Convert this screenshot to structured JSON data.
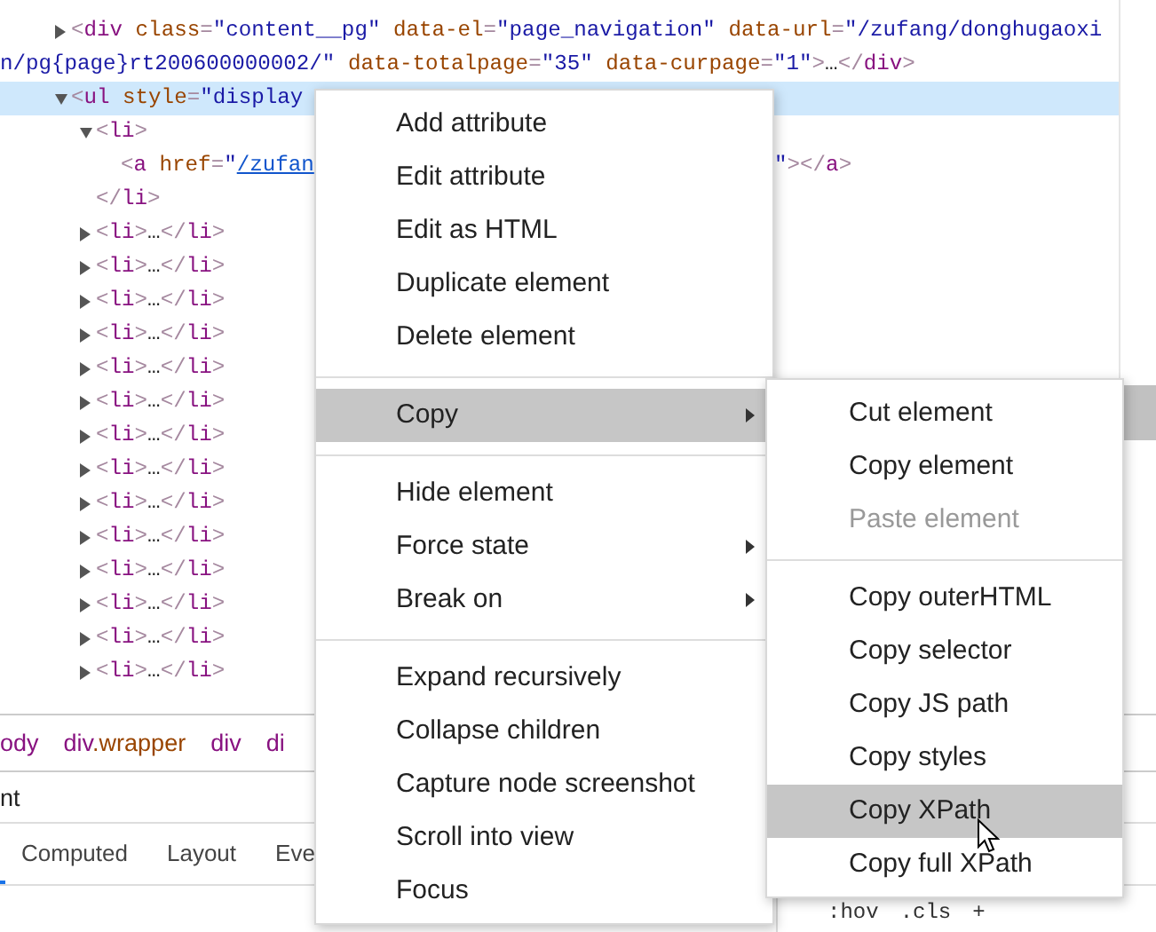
{
  "elements_tree": [
    {
      "expanded": false,
      "selected": false,
      "tokens": [
        {
          "kind": "punct",
          "text": "<"
        },
        {
          "kind": "tag",
          "text": "div"
        },
        {
          "kind": "attr",
          "text": " class"
        },
        {
          "kind": "punct",
          "text": "="
        },
        {
          "kind": "value",
          "text": "\"content__pg\""
        },
        {
          "kind": "attr",
          "text": " data-el"
        },
        {
          "kind": "punct",
          "text": "="
        },
        {
          "kind": "value",
          "text": "\"page_navigation\""
        },
        {
          "kind": "attr",
          "text": " data-url"
        },
        {
          "kind": "punct",
          "text": "="
        },
        {
          "kind": "value",
          "text": "\"/zufang/donghugaoxin/pg{page}rt200600000002/\""
        },
        {
          "kind": "attr",
          "text": " data-totalpage"
        },
        {
          "kind": "punct",
          "text": "="
        },
        {
          "kind": "value",
          "text": "\"35\""
        },
        {
          "kind": "attr",
          "text": " data-curpage"
        },
        {
          "kind": "punct",
          "text": "="
        },
        {
          "kind": "value",
          "text": "\"1\""
        },
        {
          "kind": "punct",
          "text": ">"
        },
        {
          "kind": "plain",
          "text": "…"
        },
        {
          "kind": "punct",
          "text": "</"
        },
        {
          "kind": "tag",
          "text": "div"
        },
        {
          "kind": "punct",
          "text": ">"
        }
      ]
    },
    {
      "expanded": true,
      "selected": true,
      "tokens": [
        {
          "kind": "punct",
          "text": "<"
        },
        {
          "kind": "tag",
          "text": "ul"
        },
        {
          "kind": "attr",
          "text": " style"
        },
        {
          "kind": "punct",
          "text": "="
        },
        {
          "kind": "value",
          "text": "\"display"
        }
      ],
      "children": [
        {
          "expanded": true,
          "selected": false,
          "tokens": [
            {
              "kind": "punct",
              "text": "<"
            },
            {
              "kind": "tag",
              "text": "li"
            },
            {
              "kind": "punct",
              "text": ">"
            }
          ],
          "close_tokens": [
            {
              "kind": "punct",
              "text": "</"
            },
            {
              "kind": "tag",
              "text": "li"
            },
            {
              "kind": "punct",
              "text": ">"
            }
          ],
          "children": [
            {
              "selected": false,
              "tokens": [
                {
                  "kind": "punct",
                  "text": "<"
                },
                {
                  "kind": "tag",
                  "text": "a"
                },
                {
                  "kind": "attr",
                  "text": " href"
                },
                {
                  "kind": "punct",
                  "text": "="
                },
                {
                  "kind": "value",
                  "text": "\""
                },
                {
                  "kind": "link",
                  "text": "/zufan"
                }
              ],
              "tail_tokens": [
                {
                  "kind": "value",
                  "text": "\""
                },
                {
                  "kind": "punct",
                  "text": "></"
                },
                {
                  "kind": "tag",
                  "text": "a"
                },
                {
                  "kind": "punct",
                  "text": ">"
                }
              ]
            }
          ]
        },
        {
          "expanded": false,
          "selected": false,
          "tokens": [
            {
              "kind": "punct",
              "text": "<"
            },
            {
              "kind": "tag",
              "text": "li"
            },
            {
              "kind": "punct",
              "text": ">"
            },
            {
              "kind": "plain",
              "text": "…"
            },
            {
              "kind": "punct",
              "text": "</"
            },
            {
              "kind": "tag",
              "text": "li"
            },
            {
              "kind": "punct",
              "text": ">"
            }
          ]
        },
        {
          "expanded": false,
          "selected": false,
          "tokens": [
            {
              "kind": "punct",
              "text": "<"
            },
            {
              "kind": "tag",
              "text": "li"
            },
            {
              "kind": "punct",
              "text": ">"
            },
            {
              "kind": "plain",
              "text": "…"
            },
            {
              "kind": "punct",
              "text": "</"
            },
            {
              "kind": "tag",
              "text": "li"
            },
            {
              "kind": "punct",
              "text": ">"
            }
          ]
        },
        {
          "expanded": false,
          "selected": false,
          "tokens": [
            {
              "kind": "punct",
              "text": "<"
            },
            {
              "kind": "tag",
              "text": "li"
            },
            {
              "kind": "punct",
              "text": ">"
            },
            {
              "kind": "plain",
              "text": "…"
            },
            {
              "kind": "punct",
              "text": "</"
            },
            {
              "kind": "tag",
              "text": "li"
            },
            {
              "kind": "punct",
              "text": ">"
            }
          ]
        },
        {
          "expanded": false,
          "selected": false,
          "tokens": [
            {
              "kind": "punct",
              "text": "<"
            },
            {
              "kind": "tag",
              "text": "li"
            },
            {
              "kind": "punct",
              "text": ">"
            },
            {
              "kind": "plain",
              "text": "…"
            },
            {
              "kind": "punct",
              "text": "</"
            },
            {
              "kind": "tag",
              "text": "li"
            },
            {
              "kind": "punct",
              "text": ">"
            }
          ]
        },
        {
          "expanded": false,
          "selected": false,
          "tokens": [
            {
              "kind": "punct",
              "text": "<"
            },
            {
              "kind": "tag",
              "text": "li"
            },
            {
              "kind": "punct",
              "text": ">"
            },
            {
              "kind": "plain",
              "text": "…"
            },
            {
              "kind": "punct",
              "text": "</"
            },
            {
              "kind": "tag",
              "text": "li"
            },
            {
              "kind": "punct",
              "text": ">"
            }
          ]
        },
        {
          "expanded": false,
          "selected": false,
          "tokens": [
            {
              "kind": "punct",
              "text": "<"
            },
            {
              "kind": "tag",
              "text": "li"
            },
            {
              "kind": "punct",
              "text": ">"
            },
            {
              "kind": "plain",
              "text": "…"
            },
            {
              "kind": "punct",
              "text": "</"
            },
            {
              "kind": "tag",
              "text": "li"
            },
            {
              "kind": "punct",
              "text": ">"
            }
          ]
        },
        {
          "expanded": false,
          "selected": false,
          "tokens": [
            {
              "kind": "punct",
              "text": "<"
            },
            {
              "kind": "tag",
              "text": "li"
            },
            {
              "kind": "punct",
              "text": ">"
            },
            {
              "kind": "plain",
              "text": "…"
            },
            {
              "kind": "punct",
              "text": "</"
            },
            {
              "kind": "tag",
              "text": "li"
            },
            {
              "kind": "punct",
              "text": ">"
            }
          ]
        },
        {
          "expanded": false,
          "selected": false,
          "tokens": [
            {
              "kind": "punct",
              "text": "<"
            },
            {
              "kind": "tag",
              "text": "li"
            },
            {
              "kind": "punct",
              "text": ">"
            },
            {
              "kind": "plain",
              "text": "…"
            },
            {
              "kind": "punct",
              "text": "</"
            },
            {
              "kind": "tag",
              "text": "li"
            },
            {
              "kind": "punct",
              "text": ">"
            }
          ]
        },
        {
          "expanded": false,
          "selected": false,
          "tokens": [
            {
              "kind": "punct",
              "text": "<"
            },
            {
              "kind": "tag",
              "text": "li"
            },
            {
              "kind": "punct",
              "text": ">"
            },
            {
              "kind": "plain",
              "text": "…"
            },
            {
              "kind": "punct",
              "text": "</"
            },
            {
              "kind": "tag",
              "text": "li"
            },
            {
              "kind": "punct",
              "text": ">"
            }
          ]
        },
        {
          "expanded": false,
          "selected": false,
          "tokens": [
            {
              "kind": "punct",
              "text": "<"
            },
            {
              "kind": "tag",
              "text": "li"
            },
            {
              "kind": "punct",
              "text": ">"
            },
            {
              "kind": "plain",
              "text": "…"
            },
            {
              "kind": "punct",
              "text": "</"
            },
            {
              "kind": "tag",
              "text": "li"
            },
            {
              "kind": "punct",
              "text": ">"
            }
          ]
        },
        {
          "expanded": false,
          "selected": false,
          "tokens": [
            {
              "kind": "punct",
              "text": "<"
            },
            {
              "kind": "tag",
              "text": "li"
            },
            {
              "kind": "punct",
              "text": ">"
            },
            {
              "kind": "plain",
              "text": "…"
            },
            {
              "kind": "punct",
              "text": "</"
            },
            {
              "kind": "tag",
              "text": "li"
            },
            {
              "kind": "punct",
              "text": ">"
            }
          ]
        },
        {
          "expanded": false,
          "selected": false,
          "tokens": [
            {
              "kind": "punct",
              "text": "<"
            },
            {
              "kind": "tag",
              "text": "li"
            },
            {
              "kind": "punct",
              "text": ">"
            },
            {
              "kind": "plain",
              "text": "…"
            },
            {
              "kind": "punct",
              "text": "</"
            },
            {
              "kind": "tag",
              "text": "li"
            },
            {
              "kind": "punct",
              "text": ">"
            }
          ]
        },
        {
          "expanded": false,
          "selected": false,
          "tokens": [
            {
              "kind": "punct",
              "text": "<"
            },
            {
              "kind": "tag",
              "text": "li"
            },
            {
              "kind": "punct",
              "text": ">"
            },
            {
              "kind": "plain",
              "text": "…"
            },
            {
              "kind": "punct",
              "text": "</"
            },
            {
              "kind": "tag",
              "text": "li"
            },
            {
              "kind": "punct",
              "text": ">"
            }
          ]
        },
        {
          "expanded": false,
          "selected": false,
          "tokens": [
            {
              "kind": "punct",
              "text": "<"
            },
            {
              "kind": "tag",
              "text": "li"
            },
            {
              "kind": "punct",
              "text": ">"
            },
            {
              "kind": "plain",
              "text": "…"
            },
            {
              "kind": "punct",
              "text": "</"
            },
            {
              "kind": "tag",
              "text": "li"
            },
            {
              "kind": "punct",
              "text": ">"
            }
          ]
        }
      ]
    }
  ],
  "breadcrumbs": [
    [
      {
        "kind": "tag",
        "text": "ody"
      }
    ],
    [
      {
        "kind": "tag",
        "text": "div"
      },
      {
        "kind": "attr",
        "text": ".wrapper"
      }
    ],
    [
      {
        "kind": "tag",
        "text": "div"
      }
    ],
    [
      {
        "kind": "tag",
        "text": "di"
      }
    ]
  ],
  "filter": {
    "value": "nt"
  },
  "sidebar_tabs": [
    {
      "label": "Computed",
      "selected": false
    },
    {
      "label": "Layout",
      "selected": false
    },
    {
      "label": "Eve",
      "selected": false
    }
  ],
  "styles_toolbar": [
    ":hov",
    ".cls",
    "+"
  ],
  "context_menu": {
    "items": [
      {
        "kind": "item",
        "label": "Add attribute",
        "selected": false,
        "submenu": false
      },
      {
        "kind": "item",
        "label": "Edit attribute",
        "selected": false,
        "submenu": false
      },
      {
        "kind": "item",
        "label": "Edit as HTML",
        "selected": false,
        "submenu": false
      },
      {
        "kind": "item",
        "label": "Duplicate element",
        "selected": false,
        "submenu": false
      },
      {
        "kind": "item",
        "label": "Delete element",
        "selected": false,
        "submenu": false
      },
      {
        "kind": "separator"
      },
      {
        "kind": "item",
        "label": "Copy",
        "selected": true,
        "submenu": true
      },
      {
        "kind": "separator"
      },
      {
        "kind": "item",
        "label": "Hide element",
        "selected": false,
        "submenu": false
      },
      {
        "kind": "item",
        "label": "Force state",
        "selected": false,
        "submenu": true
      },
      {
        "kind": "item",
        "label": "Break on",
        "selected": false,
        "submenu": true
      },
      {
        "kind": "separator"
      },
      {
        "kind": "item",
        "label": "Expand recursively",
        "selected": false,
        "submenu": false
      },
      {
        "kind": "item",
        "label": "Collapse children",
        "selected": false,
        "submenu": false
      },
      {
        "kind": "item",
        "label": "Capture node screenshot",
        "selected": false,
        "submenu": false
      },
      {
        "kind": "item",
        "label": "Scroll into view",
        "selected": false,
        "submenu": false
      },
      {
        "kind": "item",
        "label": "Focus",
        "selected": false,
        "submenu": false
      }
    ]
  },
  "copy_submenu": {
    "items": [
      {
        "kind": "item",
        "label": "Cut element",
        "selected": false,
        "disabled": false
      },
      {
        "kind": "item",
        "label": "Copy element",
        "selected": false,
        "disabled": false
      },
      {
        "kind": "item",
        "label": "Paste element",
        "selected": false,
        "disabled": true
      },
      {
        "kind": "separator"
      },
      {
        "kind": "item",
        "label": "Copy outerHTML",
        "selected": false,
        "disabled": false
      },
      {
        "kind": "item",
        "label": "Copy selector",
        "selected": false,
        "disabled": false
      },
      {
        "kind": "item",
        "label": "Copy JS path",
        "selected": false,
        "disabled": false
      },
      {
        "kind": "item",
        "label": "Copy styles",
        "selected": false,
        "disabled": false
      },
      {
        "kind": "item",
        "label": "Copy XPath",
        "selected": true,
        "disabled": false
      },
      {
        "kind": "item",
        "label": "Copy full XPath",
        "selected": false,
        "disabled": false
      }
    ]
  }
}
